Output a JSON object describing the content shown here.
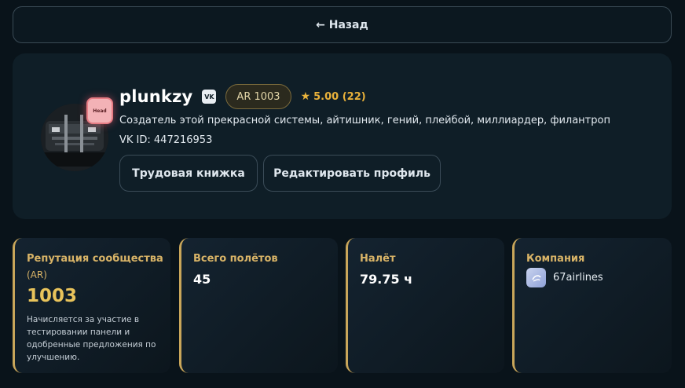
{
  "nav": {
    "back_label": "← Назад"
  },
  "profile": {
    "username": "plunkzy",
    "vk_icon_label": "VK",
    "head_badge_label": "Head",
    "ar_badge": "AR 1003",
    "rating_star": "★",
    "rating_text": "5.00 (22)",
    "bio": "Создатель этой прекрасной системы, айтишник, гений, плейбой, миллиардер, филантроп",
    "vk_id": "VK ID: 447216953",
    "buttons": {
      "work_book": "Трудовая книжка",
      "edit_profile": "Редактировать профиль"
    }
  },
  "stats": {
    "reputation": {
      "title": "Репутация сообщества",
      "subtitle": "(AR)",
      "value": "1003",
      "note": "Начисляется за участие в тестировании панели и одобренные предложения по улучшению."
    },
    "flights": {
      "title": "Всего полётов",
      "value": "45"
    },
    "hours": {
      "title": "Налёт",
      "value": "79.75 ч"
    },
    "company": {
      "title": "Компания",
      "name": "67airlines"
    }
  },
  "colors": {
    "background": "#09131a",
    "card": "#0f1e27",
    "accent_gold": "#d9b467",
    "rating": "#e8b13a",
    "badge_pink": "#f3b2b6"
  }
}
